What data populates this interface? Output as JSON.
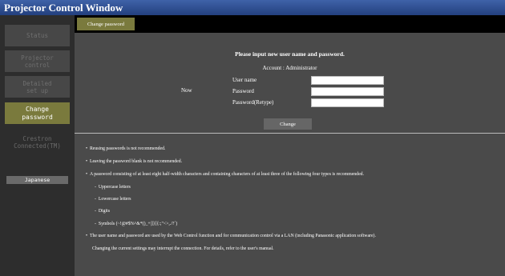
{
  "window": {
    "title": "Projector Control Window"
  },
  "sidebar": {
    "items": [
      {
        "label": "Status"
      },
      {
        "label": "Projector\ncontrol"
      },
      {
        "label": "Detailed\nset up"
      },
      {
        "label": "Change\npassword"
      },
      {
        "label": "Crestron\nConnected(TM)"
      }
    ],
    "language_button": "Japanese"
  },
  "tab": {
    "label": "Change password"
  },
  "form": {
    "title": "Please input new user name and password.",
    "account": "Account : Administrator",
    "now_label": "Now",
    "fields": [
      {
        "label": "User name",
        "value": ""
      },
      {
        "label": "Password",
        "value": ""
      },
      {
        "label": "Password(Retype)",
        "value": ""
      }
    ],
    "submit_label": "Change"
  },
  "notes": {
    "n1": "Reusing passwords is not recommended.",
    "n2": "Leaving the password blank is not recommended.",
    "n3": "A password consisting of at least eight half-width characters and containing characters of at least three of the following four types is recommended.",
    "types": [
      "Uppercase letters",
      "Lowercase letters",
      "Digits",
      "Symbols (~!@#$%^&*()_+|]}[{:;\"<>,./?`)"
    ],
    "n4": "The user name and password are used by the Web Control function and for communication control via a LAN (including Panasonic application software).",
    "n5": "Changing the current settings may interrupt the connection. For details, refer to the user's manual."
  },
  "colors": {
    "title_bar": "#2f4f93",
    "sidebar_bg": "#2d2d2d",
    "sidebar_button": "#474747",
    "active_accent": "#7a7a3d",
    "main_bg": "#4a4a4a"
  }
}
